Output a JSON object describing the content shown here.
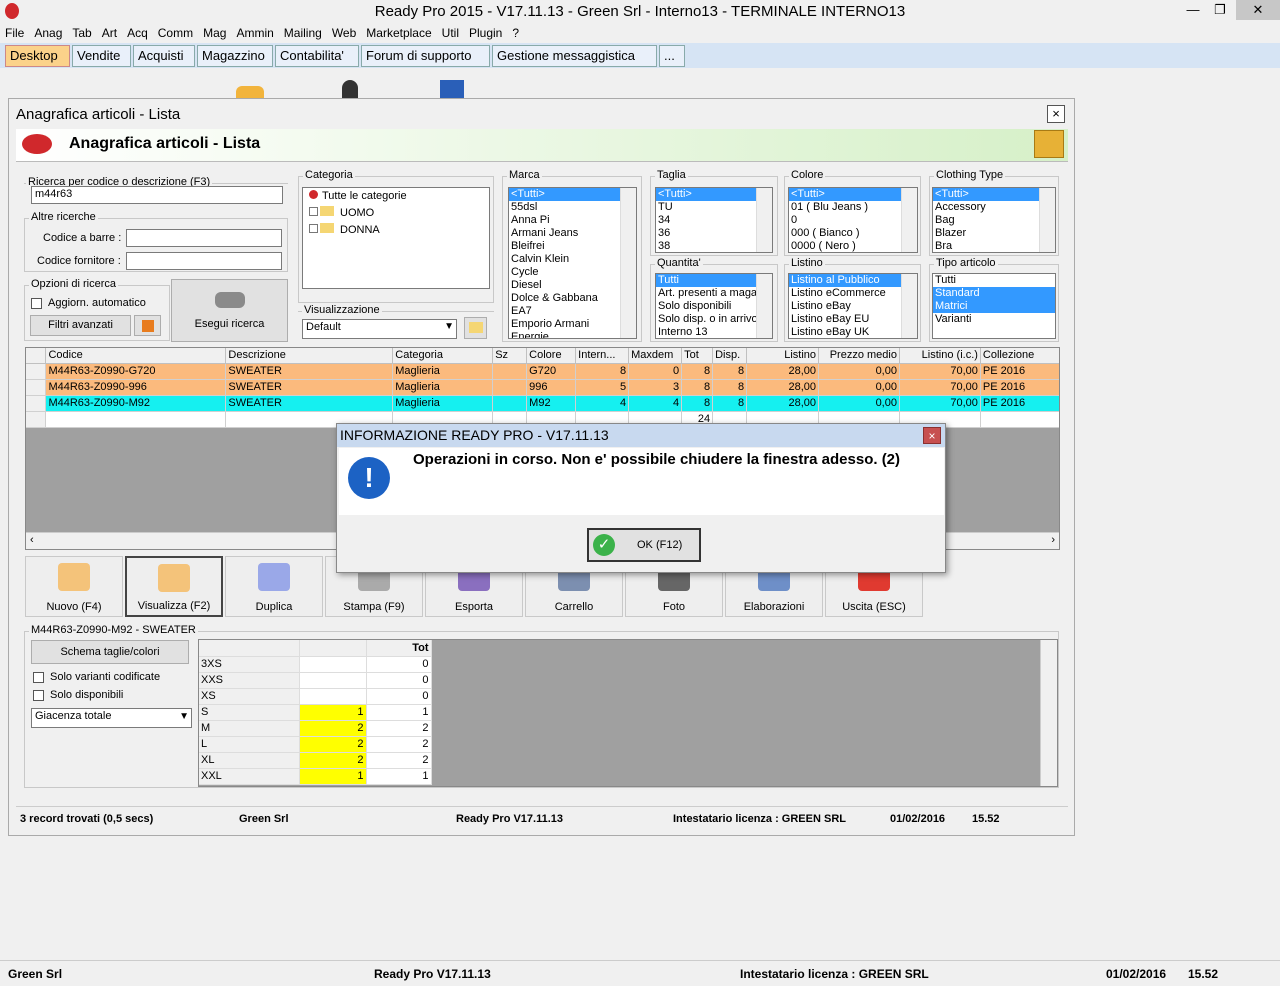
{
  "window_title": "Ready Pro 2015 - V17.11.13 - Green Srl - Interno13 - TERMINALE INTERNO13",
  "menu": [
    "File",
    "Anag",
    "Tab",
    "Art",
    "Acq",
    "Comm",
    "Mag",
    "Ammin",
    "Mailing",
    "Web",
    "Marketplace",
    "Util",
    "Plugin",
    "?"
  ],
  "tabs": [
    "Desktop",
    "Vendite",
    "Acquisti",
    "Magazzino",
    "Contabilita'",
    "Forum di supporto",
    "Gestione messaggistica",
    "..."
  ],
  "child": {
    "title": "Anagrafica articoli  - Lista",
    "header": "Anagrafica articoli  - Lista",
    "close": "×",
    "search_label": "Ricerca per codice o descrizione (F3)",
    "search_value": "m44r63",
    "altre": "Altre ricerche",
    "codice_barre": "Codice a barre :",
    "codice_fornitore": "Codice fornitore :",
    "opzioni": "Opzioni di ricerca",
    "aggiorn": "Aggiorn. automatico",
    "filtri": "Filtri avanzati",
    "esegui": "Esegui ricerca",
    "categoria": "Categoria",
    "cat_items": [
      "Tutte le categorie",
      "UOMO",
      "DONNA"
    ],
    "visualizzazione": "Visualizzazione",
    "vis_value": "Default",
    "marca": "Marca",
    "marca_items": [
      "<Tutti>",
      "55dsl",
      "Anna Pi",
      "Armani Jeans",
      "Bleifrei",
      "Calvin Klein",
      "Cycle",
      "Diesel",
      "Dolce & Gabbana",
      "EA7",
      "Emporio Armani",
      "Energie"
    ],
    "taglia": "Taglia",
    "taglia_items": [
      "<Tutti>",
      "TU",
      "34",
      "36",
      "38"
    ],
    "colore": "Colore",
    "colore_items": [
      "<Tutti>",
      "01 ( Blu Jeans )",
      "0",
      "000 ( Bianco )",
      "0000 ( Nero )"
    ],
    "clothing": "Clothing Type",
    "clothing_items": [
      "<Tutti>",
      "Accessory",
      "Bag",
      "Blazer",
      "Bra"
    ],
    "quantita": "Quantita'",
    "quantita_items": [
      "Tutti",
      "Art. presenti a magazzino",
      "Solo disponibili",
      "Solo disp. o in arrivo",
      "Interno 13"
    ],
    "listino": "Listino",
    "listino_items": [
      "Listino al Pubblico",
      "Listino eCommerce",
      "Listino eBay",
      "Listino eBay EU",
      "Listino eBay UK"
    ],
    "tipo": "Tipo articolo",
    "tipo_items": [
      "Tutti",
      "Standard",
      "Matrici",
      "Varianti"
    ]
  },
  "grid": {
    "columns": [
      "Codice",
      "Descrizione",
      "Categoria",
      "Sz",
      "Colore",
      "Intern...",
      "Maxdem",
      "Tot",
      "Disp.",
      "Listino",
      "Prezzo medio",
      "Listino (i.c.)",
      "Collezione"
    ],
    "rows": [
      [
        "M44R63-Z0990-G720",
        "SWEATER",
        "Maglieria",
        "",
        "G720",
        "8",
        "0",
        "8",
        "8",
        "28,00",
        "0,00",
        "70,00",
        "PE 2016"
      ],
      [
        "M44R63-Z0990-996",
        "SWEATER",
        "Maglieria",
        "",
        "996",
        "5",
        "3",
        "8",
        "8",
        "28,00",
        "0,00",
        "70,00",
        "PE 2016"
      ],
      [
        "M44R63-Z0990-M92",
        "SWEATER",
        "Maglieria",
        "",
        "M92",
        "4",
        "4",
        "8",
        "8",
        "28,00",
        "0,00",
        "70,00",
        "PE 2016"
      ]
    ],
    "total": "24"
  },
  "toolbar": [
    "Nuovo (F4)",
    "Visualizza (F2)",
    "Duplica",
    "Stampa (F9)",
    "Esporta",
    "Carrello",
    "Foto",
    "Elaborazioni",
    "Uscita (ESC)"
  ],
  "detail": {
    "title": "M44R63-Z0990-M92 - SWEATER",
    "schema": "Schema taglie/colori",
    "solo_var": "Solo varianti codificate",
    "solo_disp": "Solo disponibili",
    "giacenza": "Giacenza totale",
    "tot_header": "Tot",
    "sizes": [
      [
        "3XS",
        "",
        "0"
      ],
      [
        "XXS",
        "",
        "0"
      ],
      [
        "XS",
        "",
        "0"
      ],
      [
        "S",
        "1",
        "1"
      ],
      [
        "M",
        "2",
        "2"
      ],
      [
        "L",
        "2",
        "2"
      ],
      [
        "XL",
        "2",
        "2"
      ],
      [
        "XXL",
        "1",
        "1"
      ]
    ]
  },
  "inner_status": [
    "3 record trovati (0,5 secs)",
    "Green Srl",
    "Ready Pro V17.11.13",
    "Intestatario licenza : GREEN SRL",
    "01/02/2016",
    "15.52"
  ],
  "outer_status": [
    "Green Srl",
    "Ready Pro V17.11.13",
    "Intestatario licenza : GREEN SRL",
    "01/02/2016",
    "15.52"
  ],
  "dialog": {
    "title": "INFORMAZIONE READY PRO - V17.11.13",
    "message": "Operazioni in corso. Non e' possibile chiudere la finestra adesso. (2)",
    "ok": "OK (F12)",
    "close": "×"
  }
}
